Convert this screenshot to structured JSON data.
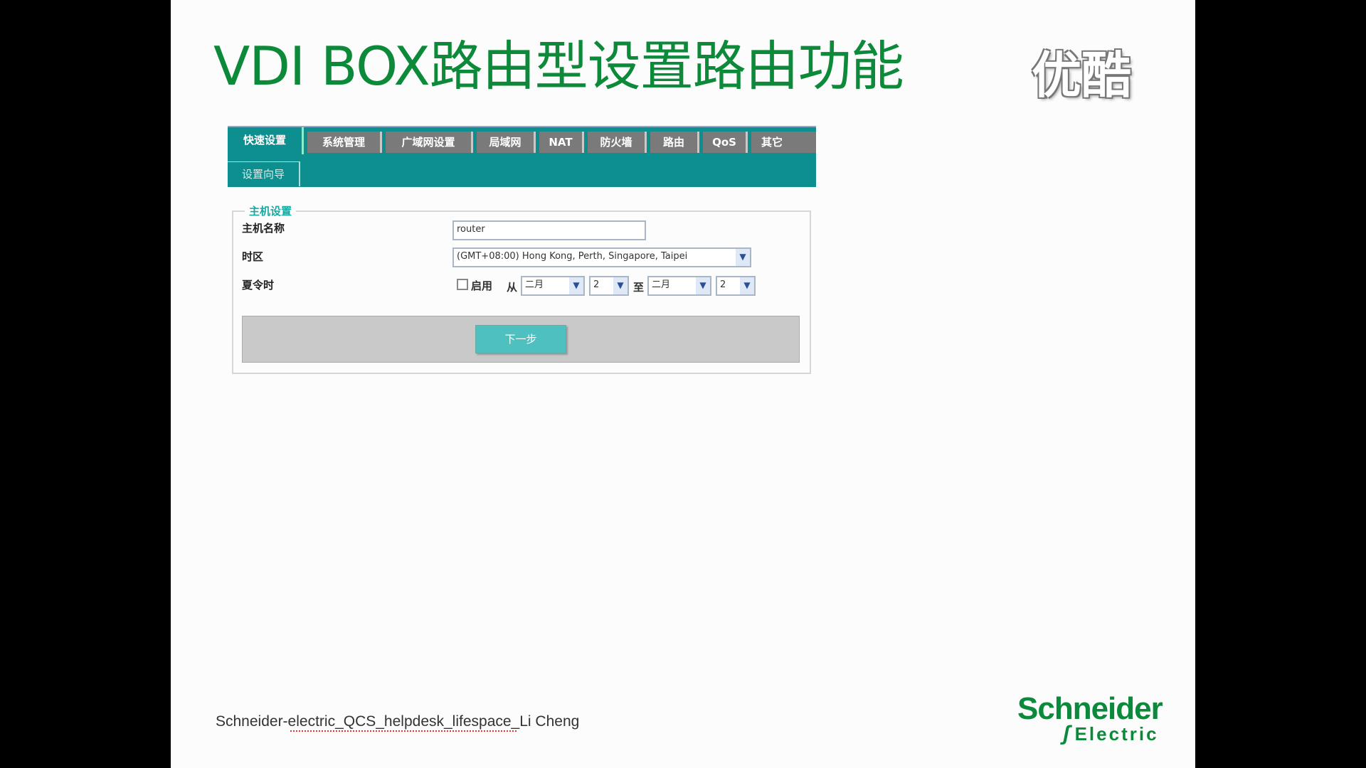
{
  "slide": {
    "title": "VDI BOX路由型设置路由功能",
    "watermark": "优酷",
    "footer": "Schneider-electric_QCS_helpdesk_lifespace_Li Cheng",
    "logo_top": "Schneider",
    "logo_bottom": "Electric"
  },
  "router": {
    "tabs": [
      "快速设置",
      "系统管理",
      "广域网设置",
      "局域网",
      "NAT",
      "防火墙",
      "路由",
      "QoS",
      "其它"
    ],
    "subtab": "设置向导",
    "section_title": "主机设置",
    "hostname_label": "主机名称",
    "hostname_value": "router",
    "timezone_label": "时区",
    "timezone_value": "(GMT+08:00) Hong Kong, Perth, Singapore, Taipei",
    "dst_label": "夏令时",
    "dst_enable": "启用",
    "dst_from": "从",
    "dst_to": "至",
    "dst_from_month": "二月",
    "dst_from_day": "2",
    "dst_to_month": "二月",
    "dst_to_day": "2",
    "next_button": "下一步"
  },
  "colors": {
    "accent": "#0e8f8f",
    "title_green": "#0c8a3a"
  }
}
